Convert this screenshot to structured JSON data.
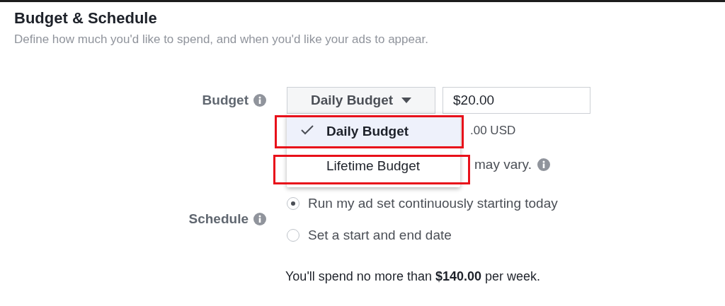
{
  "header": {
    "title": "Budget & Schedule",
    "subtitle": "Define how much you'd like to spend, and when you'd like your ads to appear."
  },
  "budget": {
    "label": "Budget",
    "type_select": "Daily Budget",
    "amount": "$20.00",
    "note_fragment": ".00 USD",
    "disclaimer_fragment": "may vary."
  },
  "budget_menu": [
    {
      "label": "Daily Budget",
      "selected": true,
      "highlighted": true
    },
    {
      "label": "Lifetime Budget",
      "selected": false,
      "highlighted": true
    }
  ],
  "schedule": {
    "label": "Schedule",
    "options": [
      {
        "label": "Run my ad set continuously starting today",
        "selected": true
      },
      {
        "label": "Set a start and end date",
        "selected": false
      }
    ]
  },
  "footer": "You'll spend no more than **$140.00** per week."
}
